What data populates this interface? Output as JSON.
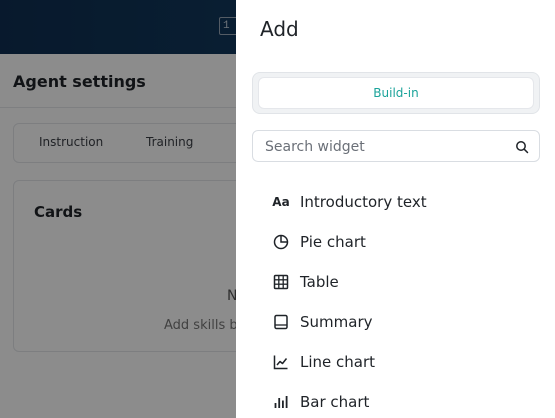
{
  "background": {
    "banner_chip": "1",
    "settings_title": "Agent settings",
    "tabs": [
      "Instruction",
      "Training"
    ],
    "cards_title": "Cards",
    "empty_heading": "N",
    "empty_text": "Add skills b"
  },
  "drawer": {
    "title": "Add",
    "segment": {
      "label": "Build-in"
    },
    "search": {
      "placeholder": "Search widget"
    },
    "widgets": [
      {
        "label": "Introductory text",
        "icon": "text-aa-icon"
      },
      {
        "label": "Pie chart",
        "icon": "pie-chart-icon"
      },
      {
        "label": "Table",
        "icon": "table-icon"
      },
      {
        "label": "Summary",
        "icon": "summary-icon"
      },
      {
        "label": "Line chart",
        "icon": "line-chart-icon"
      },
      {
        "label": "Bar chart",
        "icon": "bar-chart-icon"
      }
    ]
  },
  "colors": {
    "accent": "#1aa39a",
    "banner": "#123a5e",
    "overlay": "rgba(0,0,0,0.45)"
  }
}
